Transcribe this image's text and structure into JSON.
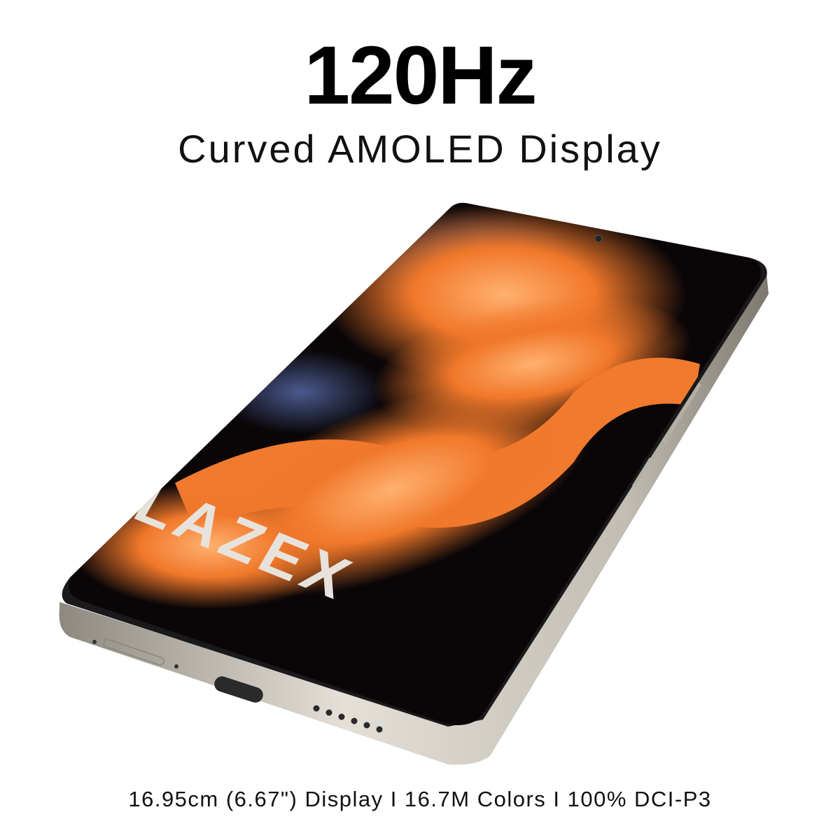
{
  "headline": "120Hz",
  "subheadline": "Curved AMOLED Display",
  "specs": "16.95cm (6.67\") Display I 16.7M Colors I 100% DCI-P3",
  "brand_logo": "BLAZEX",
  "colors": {
    "accent": "#f0782a",
    "screen_bg": "#0a0608",
    "frame": "#c9c4bb"
  }
}
